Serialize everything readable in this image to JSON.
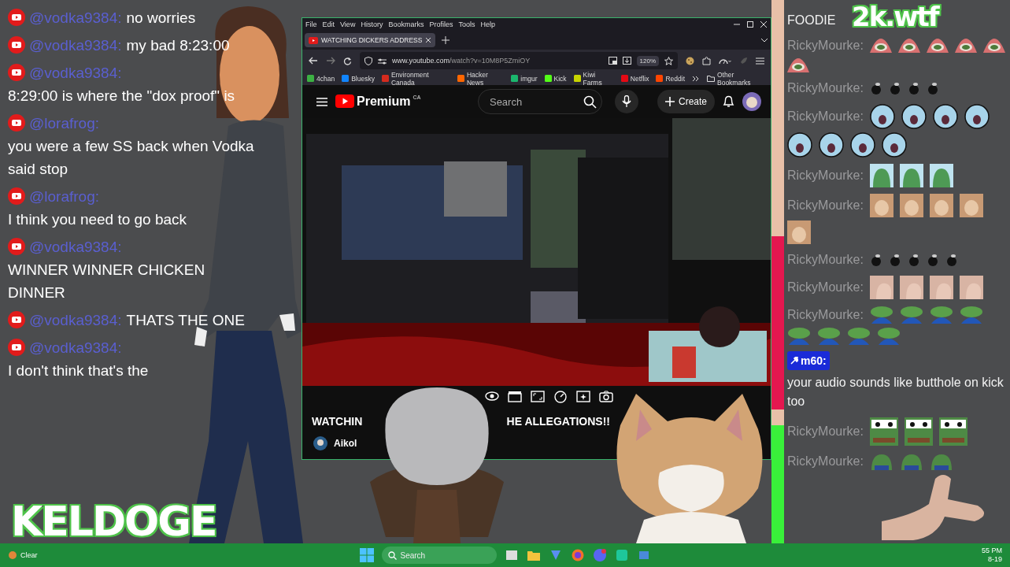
{
  "left_chat": {
    "messages": [
      {
        "user": "@vodka9384:",
        "text": "no worries"
      },
      {
        "user": "@vodka9384:",
        "text": "my bad 8:23:00"
      },
      {
        "user": "@vodka9384:",
        "text": "8:29:00 is where the \"dox proof\" is"
      },
      {
        "user": "@lorafrog:",
        "text": "you were a few SS back when Vodka said stop"
      },
      {
        "user": "@lorafrog:",
        "text": "I think you need to go back"
      },
      {
        "user": "@vodka9384:",
        "text": "WINNER WINNER CHICKEN DINNER"
      },
      {
        "user": "@vodka9384:",
        "text": "THATS THE ONE"
      },
      {
        "user": "@vodka9384:",
        "text": "I don't think that's the"
      }
    ]
  },
  "logos": {
    "left": "KELDOGE",
    "right": "2k.wtf"
  },
  "browser": {
    "menu": [
      "File",
      "Edit",
      "View",
      "History",
      "Bookmarks",
      "Profiles",
      "Tools",
      "Help"
    ],
    "tabs": [
      {
        "title": "WATCHING DICKERS ADDRESS",
        "selected": true
      }
    ],
    "url_host": "www.youtube.com",
    "url_path": "/watch?v=10M8P5ZmiOY",
    "zoom": "120%",
    "bookmarks": [
      {
        "label": "4chan",
        "color": "#3cb043"
      },
      {
        "label": "Bluesky",
        "color": "#1185fe"
      },
      {
        "label": "Environment Canada",
        "color": "#d52b1e"
      },
      {
        "label": "Hacker News",
        "color": "#ff6600"
      },
      {
        "label": "imgur",
        "color": "#1bb76e"
      },
      {
        "label": "Kick",
        "color": "#53fc18"
      },
      {
        "label": "Kiwi Farms",
        "color": "#c8d400"
      },
      {
        "label": "Netflix",
        "color": "#e50914"
      },
      {
        "label": "Reddit",
        "color": "#ff4500"
      }
    ],
    "other_bookmarks": "Other Bookmarks"
  },
  "youtube": {
    "logo": "Premium",
    "region": "CA",
    "search": {
      "placeholder": "Search"
    },
    "create": "Create",
    "video": {
      "kind": "picture"
    },
    "title_parts": [
      "WATCHIN",
      "HE ALLEGATIONS!!"
    ],
    "channel": "Aikol"
  },
  "right_chat": {
    "messages": [
      {
        "kind": "continuation",
        "text": "FOODIE"
      },
      {
        "kind": "emotes",
        "user": "RickyMourke:",
        "emotes": [
          {
            "kind": "pizza-frog"
          },
          {
            "kind": "pizza-frog"
          },
          {
            "kind": "pizza-frog"
          },
          {
            "kind": "pizza-frog"
          },
          {
            "kind": "pizza-frog"
          },
          {
            "kind": "pizza-frog"
          }
        ]
      },
      {
        "kind": "emotes",
        "user": "RickyMourke:",
        "emotes": [
          {
            "kind": "fly"
          },
          {
            "kind": "fly"
          },
          {
            "kind": "fly"
          },
          {
            "kind": "fly"
          }
        ]
      },
      {
        "kind": "emotes",
        "user": "RickyMourke:",
        "emotes": [
          {
            "kind": "blob"
          },
          {
            "kind": "blob"
          },
          {
            "kind": "blob"
          },
          {
            "kind": "blob"
          },
          {
            "kind": "blob"
          },
          {
            "kind": "blob"
          },
          {
            "kind": "blob"
          },
          {
            "kind": "blob"
          }
        ]
      },
      {
        "kind": "emotes",
        "user": "RickyMourke:",
        "emotes": [
          {
            "kind": "hooded-frog"
          },
          {
            "kind": "hooded-frog"
          },
          {
            "kind": "hooded-frog"
          }
        ]
      },
      {
        "kind": "emotes",
        "user": "RickyMourke:",
        "emotes": [
          {
            "kind": "cat"
          },
          {
            "kind": "cat"
          },
          {
            "kind": "cat"
          },
          {
            "kind": "cat"
          },
          {
            "kind": "cat"
          }
        ]
      },
      {
        "kind": "emotes",
        "user": "RickyMourke:",
        "emotes": [
          {
            "kind": "fly"
          },
          {
            "kind": "fly"
          },
          {
            "kind": "fly"
          },
          {
            "kind": "fly"
          },
          {
            "kind": "fly"
          }
        ]
      },
      {
        "kind": "emotes",
        "user": "RickyMourke:",
        "emotes": [
          {
            "kind": "hand"
          },
          {
            "kind": "hand"
          },
          {
            "kind": "hand"
          },
          {
            "kind": "hand"
          }
        ]
      },
      {
        "kind": "emotes",
        "user": "RickyMourke:",
        "emotes": [
          {
            "kind": "dancing-frog"
          },
          {
            "kind": "dancing-frog"
          },
          {
            "kind": "dancing-frog"
          },
          {
            "kind": "dancing-frog"
          },
          {
            "kind": "dancing-frog"
          },
          {
            "kind": "dancing-frog"
          },
          {
            "kind": "dancing-frog"
          },
          {
            "kind": "dancing-frog"
          }
        ]
      },
      {
        "kind": "text",
        "badge": "m60:",
        "text": "your audio sounds like butthole on kick too"
      },
      {
        "kind": "emotes",
        "user": "RickyMourke:",
        "emotes": [
          {
            "kind": "staring-frog"
          },
          {
            "kind": "staring-frog"
          },
          {
            "kind": "staring-frog"
          }
        ]
      },
      {
        "kind": "emotes",
        "user": "RickyMourke:",
        "emotes": [
          {
            "kind": "sad-frog"
          },
          {
            "kind": "sad-frog"
          },
          {
            "kind": "sad-frog"
          }
        ]
      }
    ]
  },
  "taskbar": {
    "weather": "Clear",
    "search": {
      "placeholder": "Search"
    },
    "time": "55 PM",
    "date": "8-19"
  }
}
